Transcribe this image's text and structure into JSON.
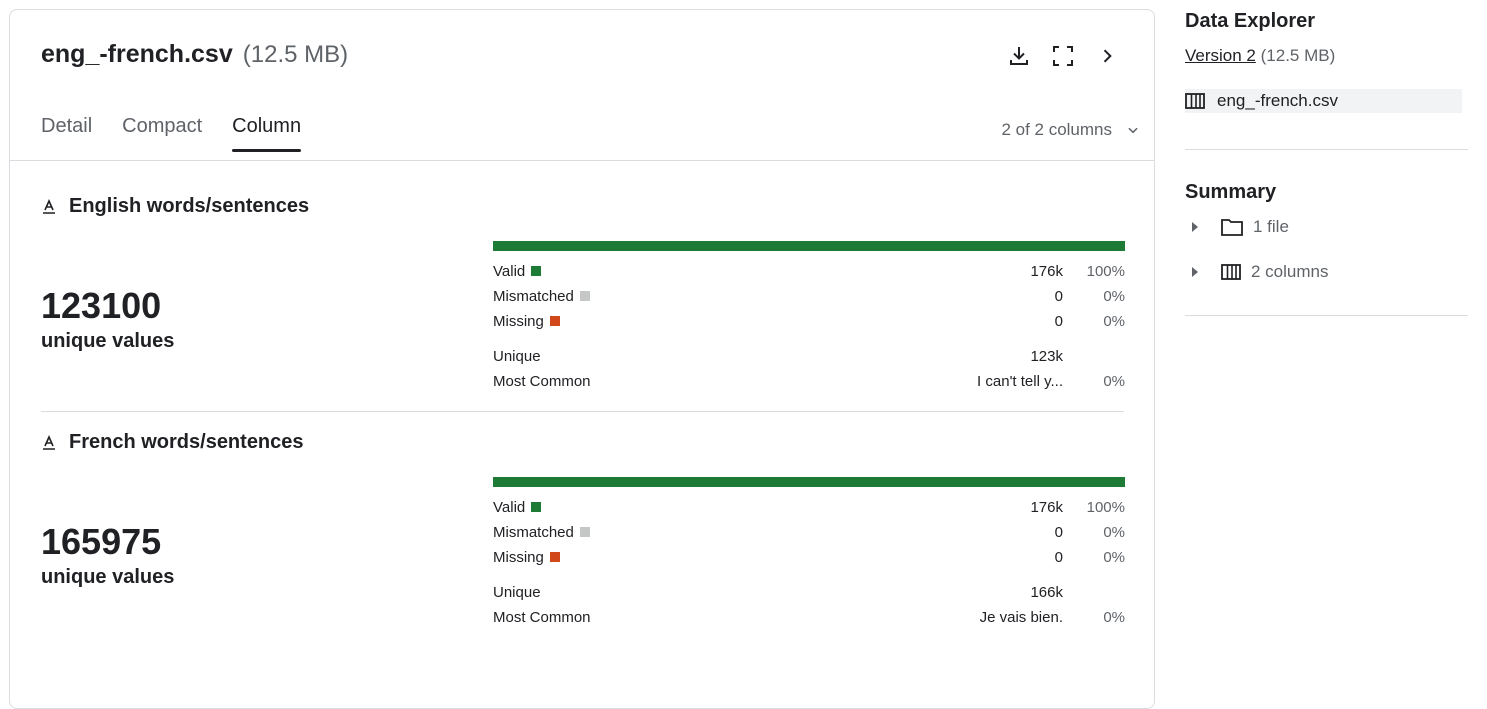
{
  "header": {
    "file_name": "eng_-french.csv",
    "file_size": "(12.5 MB)",
    "icons": [
      "download-icon",
      "fullscreen-icon",
      "chevron-right-icon"
    ]
  },
  "tabs": [
    {
      "label": "Detail",
      "active": false
    },
    {
      "label": "Compact",
      "active": false
    },
    {
      "label": "Column",
      "active": true
    }
  ],
  "column_selector": {
    "label": "2 of 2 columns"
  },
  "columns": [
    {
      "title": "English words/sentences",
      "unique_count": "123100",
      "unique_label": "unique values",
      "valid_fraction": 1.0,
      "stats": {
        "valid": {
          "label": "Valid",
          "value": "176k",
          "pct": "100%"
        },
        "mismatched": {
          "label": "Mismatched",
          "value": "0",
          "pct": "0%"
        },
        "missing": {
          "label": "Missing",
          "value": "0",
          "pct": "0%"
        },
        "unique": {
          "label": "Unique",
          "value": "123k"
        },
        "most_common": {
          "label": "Most Common",
          "value": "I can't tell y...",
          "pct": "0%"
        }
      }
    },
    {
      "title": "French words/sentences",
      "unique_count": "165975",
      "unique_label": "unique values",
      "valid_fraction": 1.0,
      "stats": {
        "valid": {
          "label": "Valid",
          "value": "176k",
          "pct": "100%"
        },
        "mismatched": {
          "label": "Mismatched",
          "value": "0",
          "pct": "0%"
        },
        "missing": {
          "label": "Missing",
          "value": "0",
          "pct": "0%"
        },
        "unique": {
          "label": "Unique",
          "value": "166k"
        },
        "most_common": {
          "label": "Most Common",
          "value": "Je vais bien.",
          "pct": "0%"
        }
      }
    }
  ],
  "colors": {
    "valid": "#1e7b35",
    "mismatched": "#c4c7c5",
    "missing": "#d1491a"
  },
  "sidebar": {
    "title": "Data Explorer",
    "version_link": "Version 2",
    "version_size": "(12.5 MB)",
    "file": "eng_-french.csv",
    "summary_title": "Summary",
    "summary_items": [
      {
        "label": "1 file",
        "icon": "folder-icon"
      },
      {
        "label": "2 columns",
        "icon": "columns-icon"
      }
    ]
  }
}
